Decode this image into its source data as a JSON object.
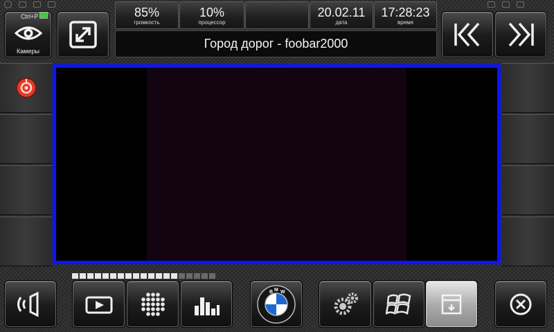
{
  "header": {
    "camera_shortcut": "Ctrl+P",
    "camera_label": "Камеры",
    "volume": {
      "value": "85%",
      "label": "громкость"
    },
    "cpu": {
      "value": "10%",
      "label": "процессор"
    },
    "date": {
      "value": "20.02.11",
      "label": "дата"
    },
    "time": {
      "value": "17:28:23",
      "label": "время"
    },
    "now_playing": "Город дорог - foobar2000"
  },
  "progress": {
    "segments_total": 19,
    "segments_filled": 14
  },
  "colors": {
    "viewport_border": "#0a14ff",
    "viewport_fill": "#120410",
    "record_red": "#e23a2c",
    "indicator_green": "#3ec93e",
    "bmw_blue": "#1c69d4"
  },
  "icons": {
    "camera_button": "eye-icon",
    "fullscreen_button": "expand-icon",
    "prev_button": "double-chevron-left-icon",
    "next_button": "double-chevron-right-icon",
    "record_button": "record-icon",
    "sound_button": "speaker-waves-icon",
    "video_button": "play-screen-icon",
    "apps_button": "grid-dots-icon",
    "eq_button": "equalizer-icon",
    "home_button": "bmw-logo-icon",
    "settings_button": "gears-icon",
    "windows_button": "windows-logo-icon",
    "minimize_button": "minimize-window-icon",
    "close_button": "close-circle-icon"
  }
}
